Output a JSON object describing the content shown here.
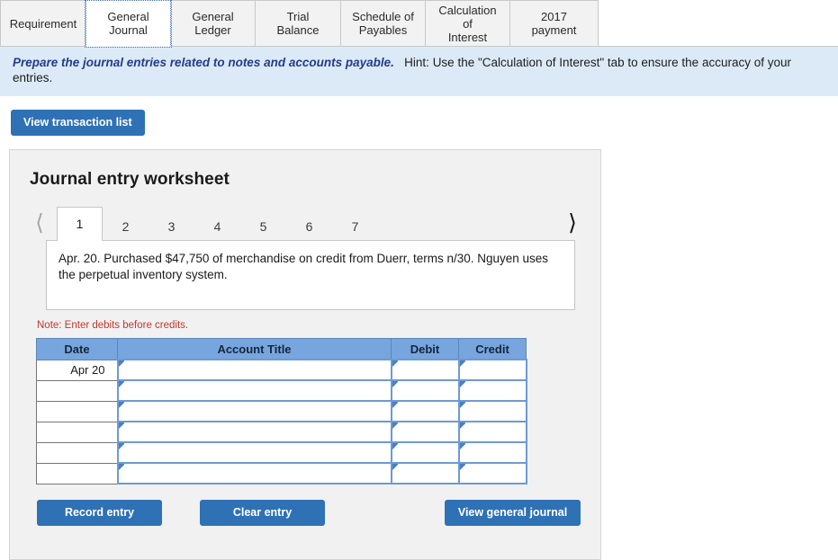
{
  "tabs": [
    {
      "label": "Requirement",
      "active": false,
      "width": 96
    },
    {
      "label": "General\nJournal",
      "active": true,
      "width": 95
    },
    {
      "label": "General\nLedger",
      "active": false,
      "width": 95
    },
    {
      "label": "Trial Balance",
      "active": false,
      "width": 96
    },
    {
      "label": "Schedule of\nPayables",
      "active": false,
      "width": 95
    },
    {
      "label": "Calculation of\nInterest",
      "active": false,
      "width": 95
    },
    {
      "label": "2017 payment",
      "active": false,
      "width": 99
    }
  ],
  "banner": {
    "requirement": "Prepare the journal entries related to notes and accounts payable.",
    "hint_label": "Hint:",
    "hint_text": "Use the \"Calculation of Interest\" tab to ensure the accuracy of your entries."
  },
  "toolbar": {
    "view_transaction_list": "View transaction list"
  },
  "worksheet": {
    "title": "Journal entry worksheet",
    "prev_icon": "chevron-left-icon",
    "next_icon": "chevron-right-icon",
    "pages": [
      "1",
      "2",
      "3",
      "4",
      "5",
      "6",
      "7"
    ],
    "active_page": "1",
    "description": "Apr. 20. Purchased $47,750 of merchandise on credit from Duerr, terms n/30. Nguyen uses the perpetual inventory system.",
    "note": "Note: Enter debits before credits.",
    "columns": [
      "Date",
      "Account Title",
      "Debit",
      "Credit"
    ],
    "rows": [
      {
        "date": "Apr 20",
        "account": "",
        "debit": "",
        "credit": ""
      },
      {
        "date": "",
        "account": "",
        "debit": "",
        "credit": ""
      },
      {
        "date": "",
        "account": "",
        "debit": "",
        "credit": ""
      },
      {
        "date": "",
        "account": "",
        "debit": "",
        "credit": ""
      },
      {
        "date": "",
        "account": "",
        "debit": "",
        "credit": ""
      },
      {
        "date": "",
        "account": "",
        "debit": "",
        "credit": ""
      }
    ],
    "buttons": {
      "record": "Record entry",
      "clear": "Clear entry",
      "view_general_journal": "View general journal"
    }
  },
  "colors": {
    "accent_blue": "#2f71b5",
    "banner_bg": "#dceaf7",
    "requirement_text": "#243c8c",
    "note_red": "#c0392b",
    "table_header_bg": "#77a5de",
    "cell_border_blue": "#6d9ad4"
  }
}
